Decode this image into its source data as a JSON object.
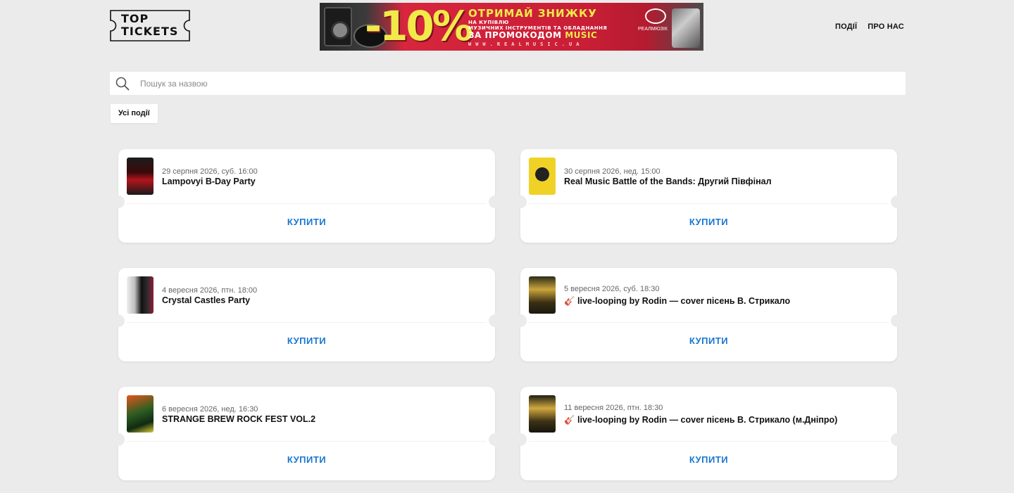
{
  "header": {
    "logo": {
      "line1": "TOP",
      "line2": "TICKETS"
    },
    "banner": {
      "discount": "-10%",
      "headline": "ОТРИМАЙ ЗНИЖКУ",
      "sub_line1": "НА КУПІВЛЮ",
      "sub_line2": "МУЗИЧНИХ ІНСТРУМЕНТІВ ТА ОБЛАДНАННЯ",
      "promo_prefix": "ЗА ПРОМОКОДОМ",
      "promo_code": "MUSIC",
      "url": "WWW.REALMUSIC.UA",
      "brand": "РЕАЛМЮЗІК"
    },
    "nav": [
      {
        "label": "ПОДІЇ"
      },
      {
        "label": "ПРО НАС"
      }
    ]
  },
  "search": {
    "placeholder": "Пошук за назвою",
    "value": ""
  },
  "filters": {
    "all_events_label": "Усі події"
  },
  "events": [
    {
      "date": "29 серпня 2026, суб. 16:00",
      "title": "Lampovyi B-Day Party",
      "buy_label": "КУПИТИ"
    },
    {
      "date": "30 серпня 2026, нед. 15:00",
      "title": "Real Music Battle of the Bands: Другий Півфінал",
      "buy_label": "КУПИТИ"
    },
    {
      "date": "4 вересня 2026, птн. 18:00",
      "title": "Crystal Castles Party",
      "buy_label": "КУПИТИ"
    },
    {
      "date": "5 вересня 2026, суб. 18:30",
      "title": "🎸 live-looping by Rodin — cover пісень В. Стрикало",
      "buy_label": "КУПИТИ"
    },
    {
      "date": "6 вересня 2026, нед. 16:30",
      "title": "STRANGE BREW ROCK FEST VOL.2",
      "buy_label": "КУПИТИ"
    },
    {
      "date": "11 вересня 2026, птн. 18:30",
      "title": "🎸 live-looping by Rodin — cover пісень В. Стрикало (м.Дніпро)",
      "buy_label": "КУПИТИ"
    }
  ],
  "colors": {
    "page_bg": "#ebebeb",
    "card_bg": "#ffffff",
    "buy_link": "#1a76d2",
    "banner_red": "#d7263d",
    "banner_yellow": "#f2e94a"
  }
}
